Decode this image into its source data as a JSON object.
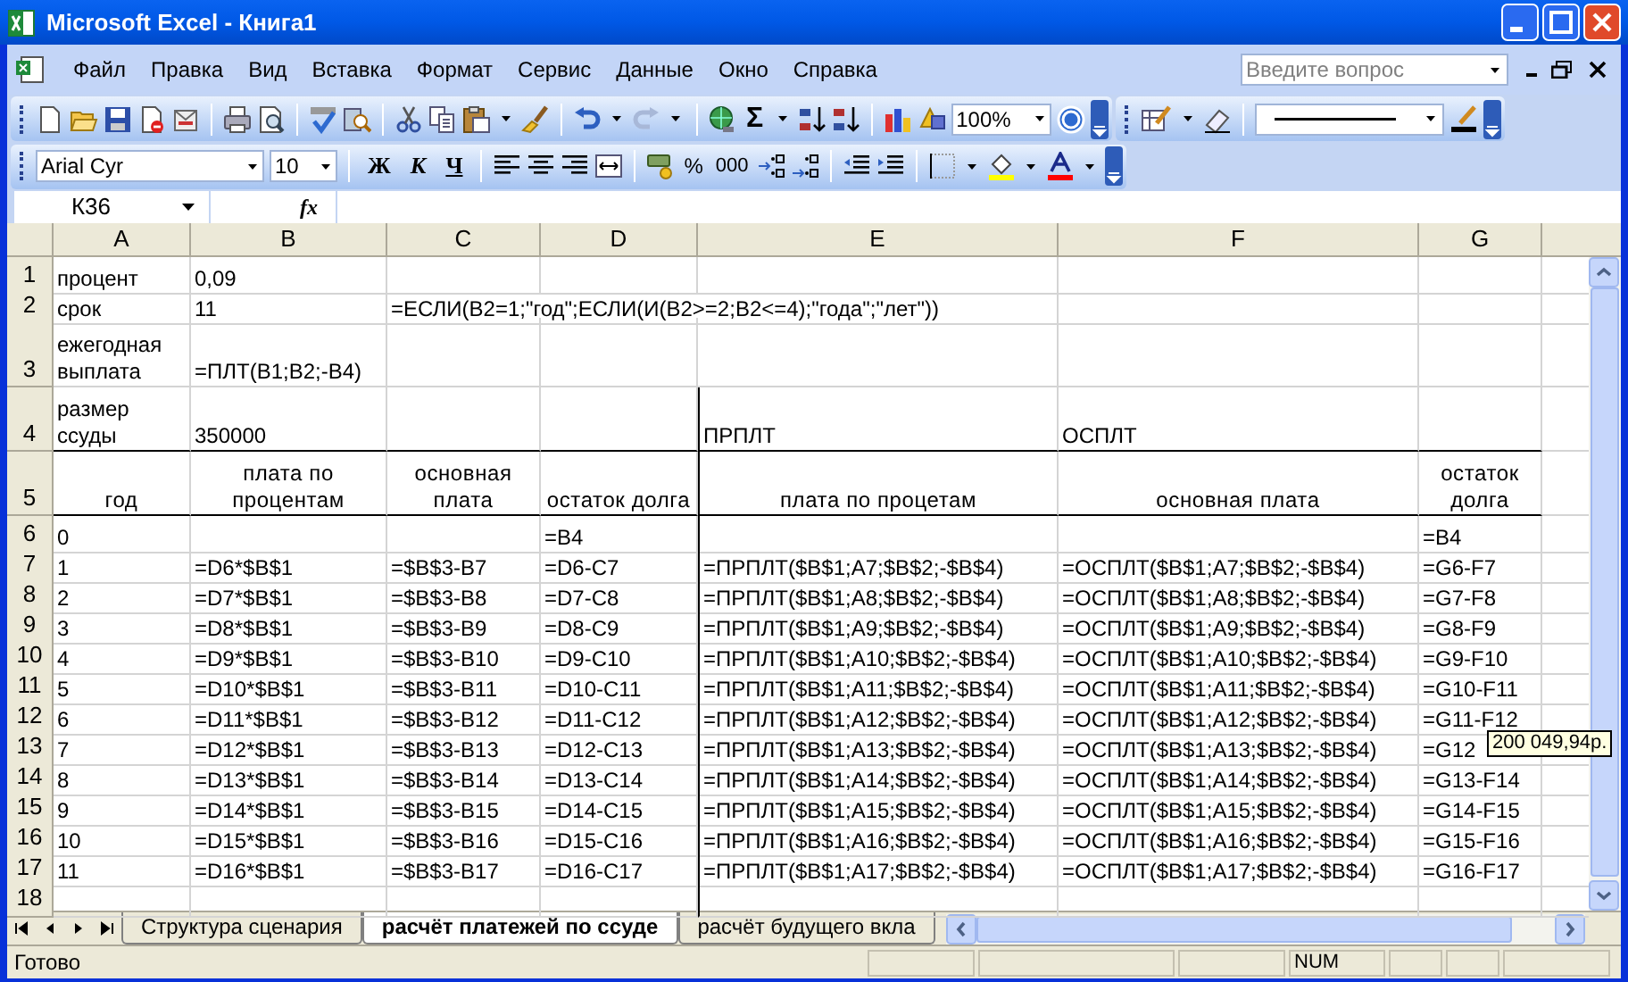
{
  "window": {
    "title": "Microsoft Excel - Книга1"
  },
  "menu": [
    {
      "label": "Файл"
    },
    {
      "label": "Правка"
    },
    {
      "label": "Вид"
    },
    {
      "label": "Вставка"
    },
    {
      "label": "Формат"
    },
    {
      "label": "Сервис"
    },
    {
      "label": "Данные"
    },
    {
      "label": "Окно"
    },
    {
      "label": "Справка"
    }
  ],
  "help_search": {
    "placeholder": "Введите вопрос"
  },
  "standard_toolbar": {
    "sum": "Σ",
    "zoom": "100%"
  },
  "formatting_toolbar": {
    "font": "Arial Cyr",
    "size": "10",
    "bold": "Ж",
    "italic": "К",
    "underline": "Ч",
    "percent": "%",
    "thousands": "000"
  },
  "name_box": "К36",
  "formula_bar": {
    "fx": "fx"
  },
  "columns": [
    "A",
    "B",
    "C",
    "D",
    "E",
    "F",
    "G"
  ],
  "rows": [
    {
      "header": "1",
      "cells": [
        "процент",
        "0,09",
        "",
        "",
        "",
        "",
        ""
      ]
    },
    {
      "header": "2",
      "cells": [
        "срок",
        "11",
        "=ЕСЛИ(B2=1;\"год\";ЕСЛИ(И(B2>=2;B2<=4);\"года\";\"лет\"))",
        "",
        "",
        "",
        ""
      ]
    },
    {
      "header": "3",
      "cells": [
        "ежегодная выплата",
        "=ПЛТ(B1;B2;-B4)",
        "",
        "",
        "",
        "",
        ""
      ]
    },
    {
      "header": "4",
      "cells": [
        "размер ссуды",
        "350000",
        "",
        "",
        "ПРПЛТ",
        "ОСПЛТ",
        ""
      ]
    },
    {
      "header": "5",
      "cells": [
        "год",
        "плата по процентам",
        "основная плата",
        "остаток долга",
        "плата по процетам",
        "основная плата",
        "остаток долга"
      ]
    },
    {
      "header": "6",
      "cells": [
        "0",
        "",
        "",
        "=B4",
        "",
        "",
        "=B4"
      ]
    },
    {
      "header": "7",
      "cells": [
        "1",
        "=D6*$B$1",
        "=$B$3-B7",
        "=D6-C7",
        "=ПРПЛТ($B$1;A7;$B$2;-$B$4)",
        "=ОСПЛТ($B$1;A7;$B$2;-$B$4)",
        "=G6-F7"
      ]
    },
    {
      "header": "8",
      "cells": [
        "2",
        "=D7*$B$1",
        "=$B$3-B8",
        "=D7-C8",
        "=ПРПЛТ($B$1;A8;$B$2;-$B$4)",
        "=ОСПЛТ($B$1;A8;$B$2;-$B$4)",
        "=G7-F8"
      ]
    },
    {
      "header": "9",
      "cells": [
        "3",
        "=D8*$B$1",
        "=$B$3-B9",
        "=D8-C9",
        "=ПРПЛТ($B$1;A9;$B$2;-$B$4)",
        "=ОСПЛТ($B$1;A9;$B$2;-$B$4)",
        "=G8-F9"
      ]
    },
    {
      "header": "10",
      "cells": [
        "4",
        "=D9*$B$1",
        "=$B$3-B10",
        "=D9-C10",
        "=ПРПЛТ($B$1;A10;$B$2;-$B$4)",
        "=ОСПЛТ($B$1;A10;$B$2;-$B$4)",
        "=G9-F10"
      ]
    },
    {
      "header": "11",
      "cells": [
        "5",
        "=D10*$B$1",
        "=$B$3-B11",
        "=D10-C11",
        "=ПРПЛТ($B$1;A11;$B$2;-$B$4)",
        "=ОСПЛТ($B$1;A11;$B$2;-$B$4)",
        "=G10-F11"
      ]
    },
    {
      "header": "12",
      "cells": [
        "6",
        "=D11*$B$1",
        "=$B$3-B12",
        "=D11-C12",
        "=ПРПЛТ($B$1;A12;$B$2;-$B$4)",
        "=ОСПЛТ($B$1;A12;$B$2;-$B$4)",
        "=G11-F12"
      ]
    },
    {
      "header": "13",
      "cells": [
        "7",
        "=D12*$B$1",
        "=$B$3-B13",
        "=D12-C13",
        "=ПРПЛТ($B$1;A13;$B$2;-$B$4)",
        "=ОСПЛТ($B$1;A13;$B$2;-$B$4)",
        "=G12"
      ]
    },
    {
      "header": "14",
      "cells": [
        "8",
        "=D13*$B$1",
        "=$B$3-B14",
        "=D13-C14",
        "=ПРПЛТ($B$1;A14;$B$2;-$B$4)",
        "=ОСПЛТ($B$1;A14;$B$2;-$B$4)",
        "=G13-F14"
      ]
    },
    {
      "header": "15",
      "cells": [
        "9",
        "=D14*$B$1",
        "=$B$3-B15",
        "=D14-C15",
        "=ПРПЛТ($B$1;A15;$B$2;-$B$4)",
        "=ОСПЛТ($B$1;A15;$B$2;-$B$4)",
        "=G14-F15"
      ]
    },
    {
      "header": "16",
      "cells": [
        "10",
        "=D15*$B$1",
        "=$B$3-B16",
        "=D15-C16",
        "=ПРПЛТ($B$1;A16;$B$2;-$B$4)",
        "=ОСПЛТ($B$1;A16;$B$2;-$B$4)",
        "=G15-F16"
      ]
    },
    {
      "header": "17",
      "cells": [
        "11",
        "=D16*$B$1",
        "=$B$3-B17",
        "=D16-C17",
        "=ПРПЛТ($B$1;A17;$B$2;-$B$4)",
        "=ОСПЛТ($B$1;A17;$B$2;-$B$4)",
        "=G16-F17"
      ]
    },
    {
      "header": "18",
      "cells": [
        "",
        "",
        "",
        "",
        "",
        "",
        ""
      ]
    }
  ],
  "tooltip": {
    "text": "200 049,94р."
  },
  "sheet_tabs": [
    {
      "label": "Структура сценария",
      "selected": false
    },
    {
      "label": "расчёт платежей по ссуде",
      "selected": true
    },
    {
      "label": "расчёт будущего вкла",
      "selected": false
    }
  ],
  "status_bar": {
    "text": "Готово",
    "indicators": [
      "NUM"
    ]
  }
}
